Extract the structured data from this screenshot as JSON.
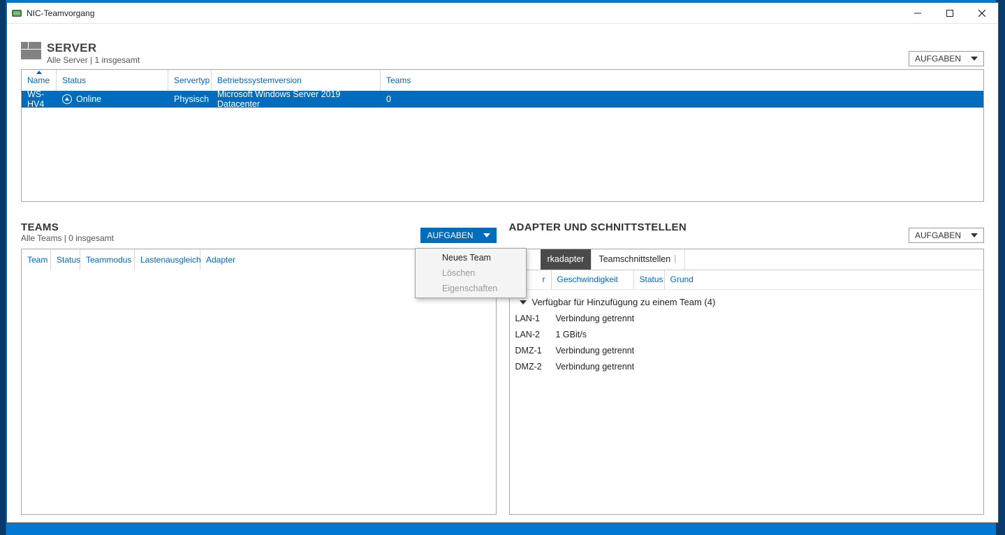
{
  "window": {
    "title": "NIC-Teamvorgang"
  },
  "server_section": {
    "title": "SERVER",
    "subtitle": "Alle Server | 1 insgesamt",
    "tasks_label": "AUFGABEN",
    "columns": {
      "name": "Name",
      "status": "Status",
      "servertype": "Servertyp",
      "osver": "Betriebssystemversion",
      "teams": "Teams"
    },
    "rows": [
      {
        "name": "WS-HV4",
        "status": "Online",
        "servertype": "Physisch",
        "osver": "Microsoft Windows Server 2019 Datacenter",
        "teams": "0"
      }
    ]
  },
  "teams_panel": {
    "title": "TEAMS",
    "subtitle": "Alle Teams | 0 insgesamt",
    "tasks_label": "AUFGABEN",
    "columns": {
      "team": "Team",
      "status": "Status",
      "mode": "Teammodus",
      "lb": "Lastenausgleich",
      "adapter": "Adapter"
    },
    "menu": {
      "new": "Neues Team",
      "delete": "Löschen",
      "props": "Eigenschaften"
    }
  },
  "adapters_panel": {
    "title": "ADAPTER UND SCHNITTSTELLEN",
    "tasks_label": "AUFGABEN",
    "tabs": {
      "net": "rkadapter",
      "team": "Teamschnittstellen"
    },
    "sub_columns": {
      "adapter_tail": "r",
      "speed": "Geschwindigkeit",
      "status": "Status",
      "reason": "Grund"
    },
    "group_label": "Verfügbar für Hinzufügung zu einem Team (4)",
    "rows": [
      {
        "name": "LAN-1",
        "speed": "Verbindung getrennt"
      },
      {
        "name": "LAN-2",
        "speed": "1 GBit/s"
      },
      {
        "name": "DMZ-1",
        "speed": "Verbindung getrennt"
      },
      {
        "name": "DMZ-2",
        "speed": "Verbindung getrennt"
      }
    ]
  }
}
